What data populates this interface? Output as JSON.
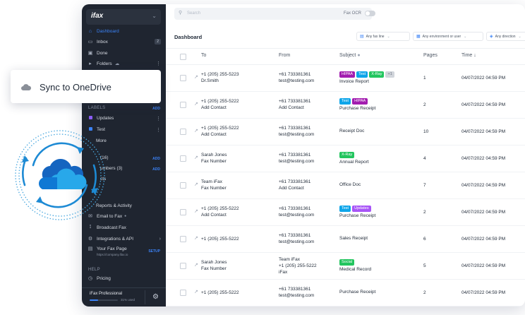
{
  "overlay": {
    "sync_label": "Sync to OneDrive"
  },
  "sidebar": {
    "logo": "ifax",
    "nav_top": [
      {
        "label": "Dashboard",
        "icon": "home-icon",
        "active": true
      },
      {
        "label": "Inbox",
        "icon": "inbox-icon",
        "badge": "2"
      },
      {
        "label": "Done",
        "icon": "done-icon"
      },
      {
        "label": "Folders",
        "icon": "folder-icon"
      }
    ],
    "labels_header": "LABELS",
    "add_label": "ADD",
    "labels": [
      {
        "label": "Updates",
        "color": "#8b5cf6"
      },
      {
        "label": "Test",
        "color": "#3b82f6"
      }
    ],
    "more": "More",
    "contacts_count": "(16)",
    "add_contacts": "ADD",
    "numbers_label": "umbers (3)",
    "add_numbers": "ADD",
    "projects_label": "cts",
    "nav_bottom": [
      {
        "label": "Reports & Activity",
        "icon": "reports-icon"
      },
      {
        "label": "Email to Fax",
        "icon": "email-icon"
      },
      {
        "label": "Broadcast Fax",
        "icon": "broadcast-icon"
      },
      {
        "label": "Integrations & API",
        "icon": "integrations-icon"
      }
    ],
    "fax_page": "Your Fax Page",
    "fax_page_url": "https://company.ifax.io",
    "setup": "SETUP",
    "help_header": "HELP",
    "pricing": "Pricing",
    "plan_name": "iFax Professional",
    "plan_used": "31% used",
    "plan_fraction": 0.31
  },
  "topbar": {
    "search_placeholder": "Search",
    "fax_ocr": "Fax OCR",
    "fax_ocr_on": false
  },
  "header": {
    "title": "Dashboard",
    "filters": [
      "Any fax line",
      "Any environment or user",
      "Any direction"
    ]
  },
  "table": {
    "columns": [
      "To",
      "From",
      "Subject",
      "Pages",
      "Time"
    ],
    "rows": [
      {
        "to": [
          "+1 (205) 255-5223",
          "Dr.Smith"
        ],
        "from": [
          "+61 733381361",
          "test@testing.com"
        ],
        "tags": [
          {
            "t": "HIPAA",
            "c": "#a21caf"
          },
          {
            "t": "Test",
            "c": "#0ea5e9"
          },
          {
            "t": "X-Ray",
            "c": "#22c55e"
          },
          {
            "t": "+1",
            "c": "#d1d5db"
          }
        ],
        "subject": "Invoice Report",
        "pages": "1",
        "time": "04/07/2022 04:59 PM"
      },
      {
        "to": [
          "+1 (205) 255-5222",
          "Add Contact"
        ],
        "from": [
          "+61 733381361",
          "Add Contact"
        ],
        "tags": [
          {
            "t": "Test",
            "c": "#0ea5e9"
          },
          {
            "t": "HIPAA",
            "c": "#a21caf"
          }
        ],
        "subject": "Purchase Receipt",
        "pages": "2",
        "time": "04/07/2022 04:59 PM"
      },
      {
        "to": [
          "+1 (205) 255-5222",
          "Add Contact"
        ],
        "from": [
          "+61 733381361",
          "test@testing.com"
        ],
        "tags": [],
        "subject": "Receipt Doc",
        "pages": "10",
        "time": "04/07/2022 04:59 PM"
      },
      {
        "to": [
          "Sarah Jones",
          "Fax Number"
        ],
        "from": [
          "+61 733381361",
          "test@testing.com"
        ],
        "tags": [
          {
            "t": "X-Ray",
            "c": "#22c55e"
          }
        ],
        "subject": "Annual Report",
        "pages": "4",
        "time": "04/07/2022 04:59 PM"
      },
      {
        "to": [
          "Team iFax",
          "Fax Number"
        ],
        "from": [
          "+61 733381361",
          "Add Contact"
        ],
        "tags": [],
        "subject": "Office Doc",
        "pages": "7",
        "time": "04/07/2022 04:59 PM"
      },
      {
        "to": [
          "+1 (205) 255-5222",
          "Add Contact"
        ],
        "from": [
          "+61 733381361",
          "test@testing.com"
        ],
        "tags": [
          {
            "t": "Test",
            "c": "#0ea5e9"
          },
          {
            "t": "Updates",
            "c": "#a855f7"
          }
        ],
        "subject": "Purchase Receipt",
        "pages": "2",
        "time": "04/07/2022 04:59 PM"
      },
      {
        "to": [
          "+1 (205) 255-5222"
        ],
        "from": [
          "+61 733381361",
          "test@testing.com"
        ],
        "tags": [],
        "subject": "Sales Receipt",
        "pages": "6",
        "time": "04/07/2022 04:59 PM"
      },
      {
        "to": [
          "Sarah Jones",
          "Fax Number"
        ],
        "from": [
          "Team iFax",
          "+1 (205) 255-5222",
          "iFax"
        ],
        "tags": [
          {
            "t": "Social",
            "c": "#22c55e"
          }
        ],
        "subject": "Medical Record",
        "pages": "5",
        "time": "04/07/2022 04:59 PM"
      },
      {
        "to": [
          "+1 (205) 255-5222"
        ],
        "from": [
          "+61 733381361",
          "test@testing.com"
        ],
        "tags": [],
        "subject": "Purchase Receipt",
        "pages": "2",
        "time": "04/07/2022 04:59 PM"
      }
    ]
  }
}
